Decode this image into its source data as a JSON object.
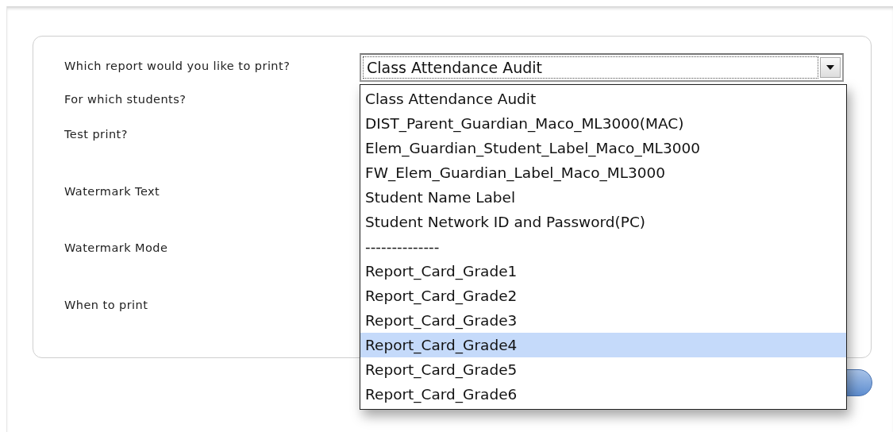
{
  "form": {
    "fields": [
      {
        "label": "Which report would you like to print?"
      },
      {
        "label": "For which students?"
      },
      {
        "label": "Test print?"
      },
      {
        "label": "Watermark Text"
      },
      {
        "label": "Watermark Mode"
      },
      {
        "label": "When to print"
      }
    ],
    "report_select": {
      "value": "Class Attendance Audit",
      "options": [
        {
          "label": "Class Attendance Audit",
          "highlighted": false
        },
        {
          "label": "DIST_Parent_Guardian_Maco_ML3000(MAC)",
          "highlighted": false
        },
        {
          "label": "Elem_Guardian_Student_Label_Maco_ML3000",
          "highlighted": false
        },
        {
          "label": "FW_Elem_Guardian_Label_Maco_ML3000",
          "highlighted": false
        },
        {
          "label": "Student Name Label",
          "highlighted": false
        },
        {
          "label": "Student Network ID and Password(PC)",
          "highlighted": false
        },
        {
          "label": "--------------",
          "highlighted": false
        },
        {
          "label": "Report_Card_Grade1",
          "highlighted": false
        },
        {
          "label": "Report_Card_Grade2",
          "highlighted": false
        },
        {
          "label": "Report_Card_Grade3",
          "highlighted": false
        },
        {
          "label": "Report_Card_Grade4",
          "highlighted": true
        },
        {
          "label": "Report_Card_Grade5",
          "highlighted": false
        },
        {
          "label": "Report_Card_Grade6",
          "highlighted": false
        }
      ]
    }
  }
}
